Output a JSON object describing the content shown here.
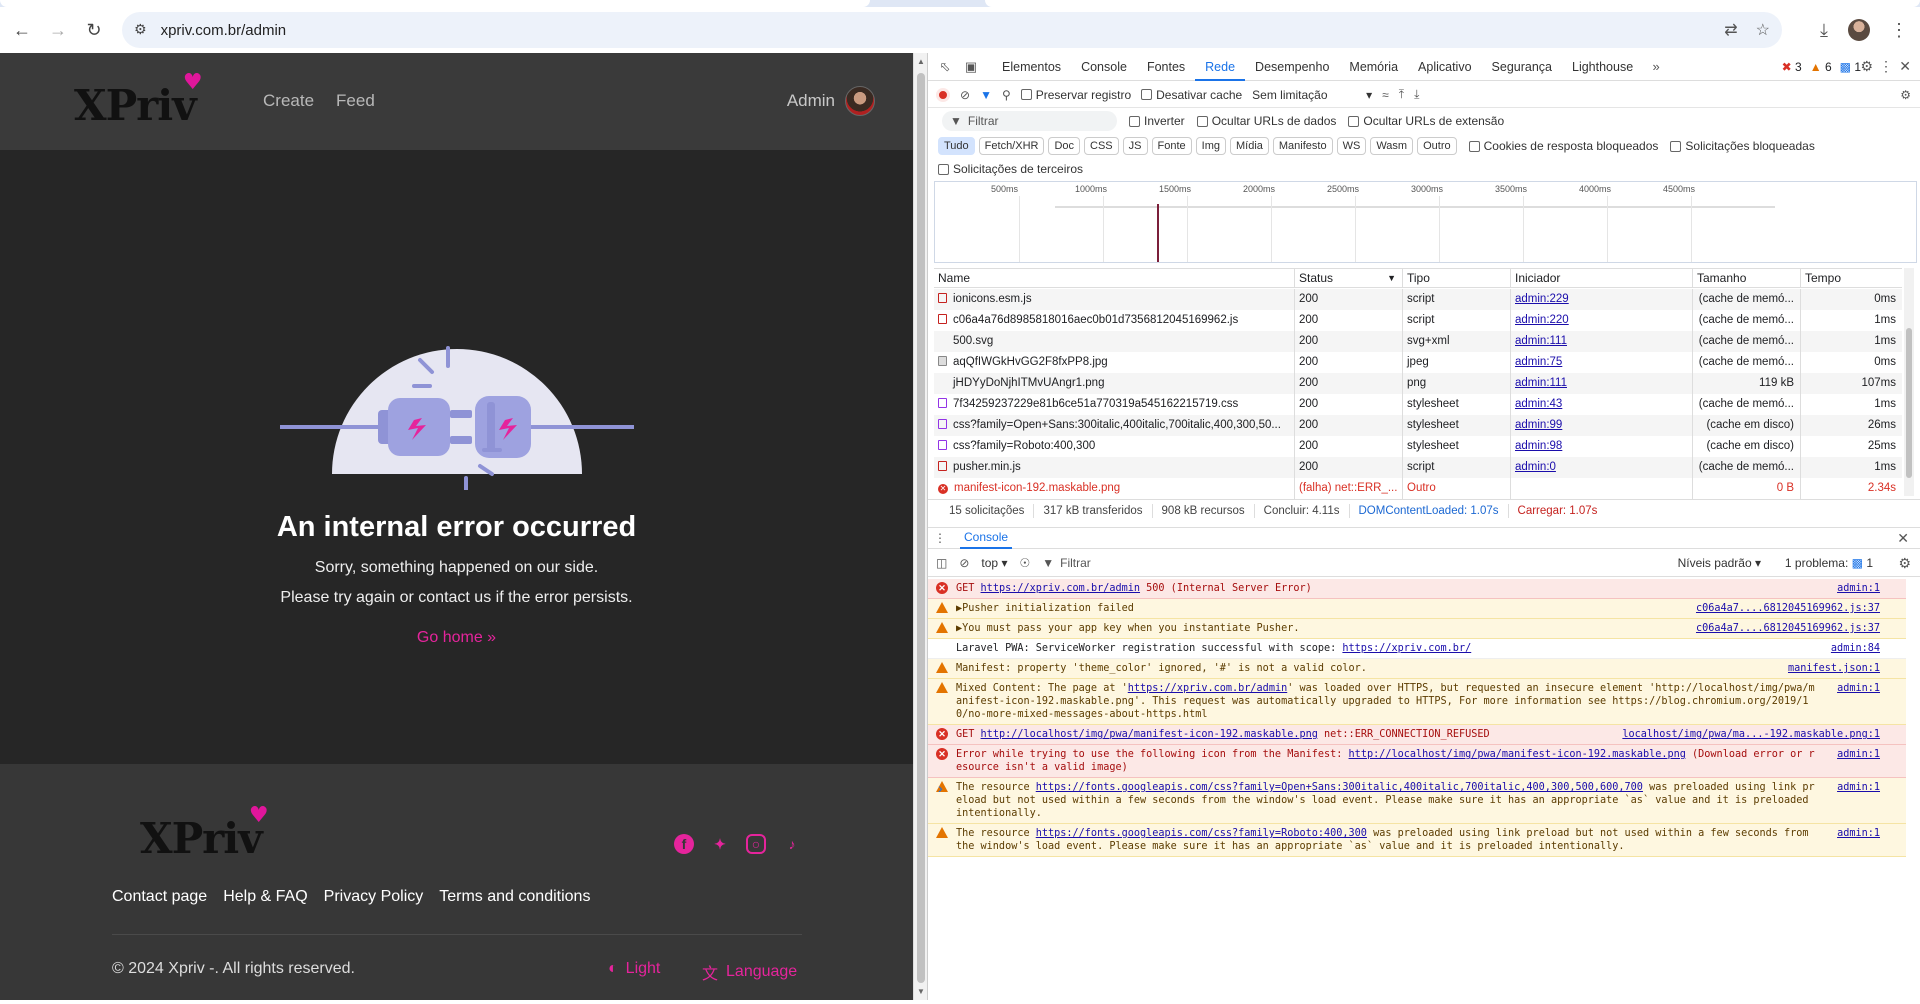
{
  "browser": {
    "url": "xpriv.com.br/admin"
  },
  "site": {
    "logo_text": "XPriv",
    "nav": [
      "Create",
      "Feed"
    ],
    "user_name": "Admin"
  },
  "error": {
    "title": "An internal error occurred",
    "line1": "Sorry, something happened on our side.",
    "line2": "Please try again or contact us if the error persists.",
    "go_home": "Go home »"
  },
  "footer": {
    "links": [
      "Contact page",
      "Help & FAQ",
      "Privacy Policy",
      "Terms and conditions"
    ],
    "copyright": "© 2024 Xpriv -. All rights reserved.",
    "theme_label": "Light",
    "language_label": "Language"
  },
  "devtools": {
    "tabs": [
      "Elementos",
      "Console",
      "Fontes",
      "Rede",
      "Desempenho",
      "Memória",
      "Aplicativo",
      "Segurança",
      "Lighthouse"
    ],
    "active_tab": "Rede",
    "counts": {
      "errors": "3",
      "warnings": "6",
      "issues": "1"
    },
    "network_toolbar": {
      "preserve_log": "Preservar registro",
      "disable_cache": "Desativar cache",
      "throttling": "Sem limitação"
    },
    "filter_row": {
      "placeholder": "Filtrar",
      "invert": "Inverter",
      "hide_data_urls": "Ocultar URLs de dados",
      "hide_extension_urls": "Ocultar URLs de extensão"
    },
    "type_filters": [
      "Tudo",
      "Fetch/XHR",
      "Doc",
      "CSS",
      "JS",
      "Fonte",
      "Img",
      "Mídia",
      "Manifesto",
      "WS",
      "Wasm",
      "Outro"
    ],
    "blocked_cookies": "Cookies de resposta bloqueados",
    "blocked_requests": "Solicitações bloqueadas",
    "third_party": "Solicitações de terceiros",
    "timeline_ticks": [
      "500ms",
      "1000ms",
      "1500ms",
      "2000ms",
      "2500ms",
      "3000ms",
      "3500ms",
      "4000ms",
      "4500ms"
    ],
    "columns": [
      "Name",
      "Status",
      "Tipo",
      "Iniciador",
      "Tamanho",
      "Tempo"
    ],
    "rows": [
      {
        "name": "ionicons.esm.js",
        "status": "200",
        "type": "script",
        "initiator": "admin:229",
        "size": "(cache de memó...",
        "time": "0ms",
        "icon": "js"
      },
      {
        "name": "c06a4a76d8985818016aec0b01d7356812045169962.js",
        "status": "200",
        "type": "script",
        "initiator": "admin:220",
        "size": "(cache de memó...",
        "time": "1ms",
        "icon": "js"
      },
      {
        "name": "500.svg",
        "status": "200",
        "type": "svg+xml",
        "initiator": "admin:111",
        "size": "(cache de memó...",
        "time": "1ms",
        "icon": "svg"
      },
      {
        "name": "aqQfIWGkHvGG2F8fxPP8.jpg",
        "status": "200",
        "type": "jpeg",
        "initiator": "admin:75",
        "size": "(cache de memó...",
        "time": "0ms",
        "icon": "img"
      },
      {
        "name": "jHDYyDoNjhITMvUAngr1.png",
        "status": "200",
        "type": "png",
        "initiator": "admin:111",
        "size": "119 kB",
        "time": "107ms",
        "icon": "svg"
      },
      {
        "name": "7f34259237229e81b6ce51a770319a545162215719.css",
        "status": "200",
        "type": "stylesheet",
        "initiator": "admin:43",
        "size": "(cache de memó...",
        "time": "1ms",
        "icon": "css"
      },
      {
        "name": "css?family=Open+Sans:300italic,400italic,700italic,400,300,50...",
        "status": "200",
        "type": "stylesheet",
        "initiator": "admin:99",
        "size": "(cache em disco)",
        "time": "26ms",
        "icon": "css"
      },
      {
        "name": "css?family=Roboto:400,300",
        "status": "200",
        "type": "stylesheet",
        "initiator": "admin:98",
        "size": "(cache em disco)",
        "time": "25ms",
        "icon": "css"
      },
      {
        "name": "pusher.min.js",
        "status": "200",
        "type": "script",
        "initiator": "admin:0",
        "size": "(cache de memó...",
        "time": "1ms",
        "icon": "js"
      },
      {
        "name": "manifest-icon-192.maskable.png",
        "status": "(falha) net::ERR_...",
        "type": "Outro",
        "initiator": "",
        "size": "0 B",
        "time": "2.34s",
        "icon": "err"
      }
    ],
    "summary": {
      "requests": "15 solicitações",
      "transferred": "317 kB transferidos",
      "resources": "908 kB recursos",
      "finish": "Concluir: 4.11s",
      "dcl": "DOMContentLoaded: 1.07s",
      "load": "Carregar: 1.07s"
    },
    "console": {
      "tab_label": "Console",
      "context": "top",
      "filter_placeholder": "Filtrar",
      "levels": "Níveis padrão",
      "issues": "1 problema:",
      "issues_count": "1",
      "messages": [
        {
          "level": "error",
          "pre": "GET ",
          "link": "https://xpriv.com.br/admin",
          "post": " 500 (Internal Server Error)",
          "src": "admin:1"
        },
        {
          "level": "warning",
          "pre": "▶Pusher initialization failed",
          "link": "",
          "post": "",
          "src": "c06a4a7....6812045169962.js:37"
        },
        {
          "level": "warning",
          "pre": "▶You must pass your app key when you instantiate Pusher.",
          "link": "",
          "post": "",
          "src": "c06a4a7....6812045169962.js:37"
        },
        {
          "level": "info",
          "pre": "Laravel PWA: ServiceWorker registration successful with scope:  ",
          "link": "https://xpriv.com.br/",
          "post": "",
          "src": "admin:84"
        },
        {
          "level": "warning",
          "pre": "Manifest: property 'theme_color' ignored, '#' is not a valid color.",
          "link": "",
          "post": "",
          "src": "manifest.json:1"
        },
        {
          "level": "warning",
          "pre": "Mixed Content: The page at '",
          "link": "https://xpriv.com.br/admin",
          "post": "' was loaded over HTTPS, but requested an insecure element 'http://localhost/img/pwa/manifest-icon-192.maskable.png'. This request was automatically upgraded to HTTPS, For more information see https://blog.chromium.org/2019/10/no-more-mixed-messages-about-https.html",
          "src": "admin:1"
        },
        {
          "level": "error",
          "pre": "GET ",
          "link": "http://localhost/img/pwa/manifest-icon-192.maskable.png",
          "post": " net::ERR_CONNECTION_REFUSED",
          "src": "localhost/img/pwa/ma...-192.maskable.png:1"
        },
        {
          "level": "error",
          "pre": "Error while trying to use the following icon from the Manifest: ",
          "link": "http://localhost/img/pwa/manifest-icon-192.maskable.png",
          "post": " (Download error or resource isn't a valid image)",
          "src": "admin:1"
        },
        {
          "level": "warning",
          "pre": "The resource ",
          "link": "https://fonts.googleapis.com/css?family=Open+Sans:300italic,400italic,700italic,400,300,500,600,700",
          "post": " was preloaded using link preload but not used within a few seconds from the window's load event. Please make sure it has an appropriate `as` value and it is preloaded intentionally.",
          "src": "admin:1"
        },
        {
          "level": "warning",
          "pre": "The resource ",
          "link": "https://fonts.googleapis.com/css?family=Roboto:400,300",
          "post": " was preloaded using link preload but not used within a few seconds from the window's load event. Please make sure it has an appropriate `as` value and it is preloaded intentionally.",
          "src": "admin:1"
        }
      ]
    }
  },
  "colors": {
    "accent": "#e5249c",
    "devtools_blue": "#1a73e8",
    "error_red": "#d93025",
    "warning_orange": "#e37400"
  }
}
